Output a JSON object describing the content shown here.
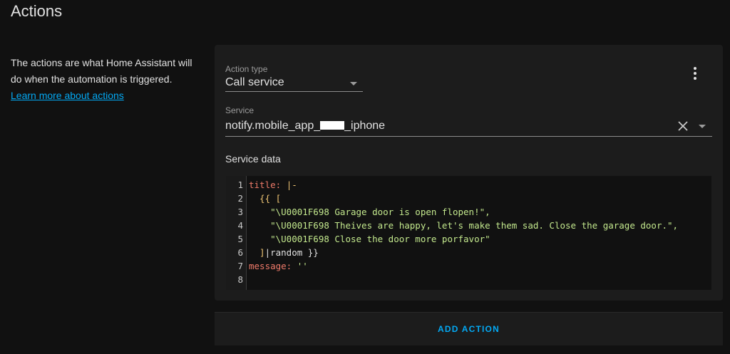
{
  "section": {
    "title": "Actions",
    "description": "The actions are what Home Assistant will do when the automation is triggered.",
    "learn_more": "Learn more about actions"
  },
  "action": {
    "type_label": "Action type",
    "type_value": "Call service",
    "service_label": "Service",
    "service_value_prefix": "notify.mobile_app_",
    "service_value_suffix": "_iphone",
    "service_data_label": "Service data"
  },
  "editor": {
    "lines": [
      {
        "num": "1",
        "tokens": [
          {
            "t": "title:",
            "c": "key"
          },
          {
            "t": " ",
            "c": "plain"
          },
          {
            "t": "|-",
            "c": "punc"
          }
        ]
      },
      {
        "num": "2",
        "tokens": [
          {
            "t": "  {{ [",
            "c": "punc"
          }
        ]
      },
      {
        "num": "3",
        "tokens": [
          {
            "t": "    \"\\U0001F698 Garage door is open flopen!\",",
            "c": "str"
          }
        ]
      },
      {
        "num": "4",
        "tokens": [
          {
            "t": "    \"\\U0001F698 Theives are happy, let's make them sad. Close the garage door.\",",
            "c": "str"
          }
        ]
      },
      {
        "num": "5",
        "tokens": [
          {
            "t": "    \"\\U0001F698 Close the door more porfavor\"",
            "c": "str"
          }
        ]
      },
      {
        "num": "6",
        "tokens": [
          {
            "t": "  ]",
            "c": "punc"
          },
          {
            "t": "|random }}",
            "c": "plain"
          }
        ]
      },
      {
        "num": "7",
        "tokens": [
          {
            "t": "message:",
            "c": "key"
          },
          {
            "t": " ",
            "c": "plain"
          },
          {
            "t": "''",
            "c": "str"
          }
        ]
      },
      {
        "num": "8",
        "tokens": []
      }
    ]
  },
  "buttons": {
    "add_action": "ADD ACTION"
  },
  "icons": {
    "more": "dots-vertical-icon",
    "clear": "close-icon",
    "dropdown": "menu-down-icon"
  },
  "colors": {
    "accent": "#03a9f4",
    "card": "#1c1c1c",
    "background": "#111111"
  }
}
